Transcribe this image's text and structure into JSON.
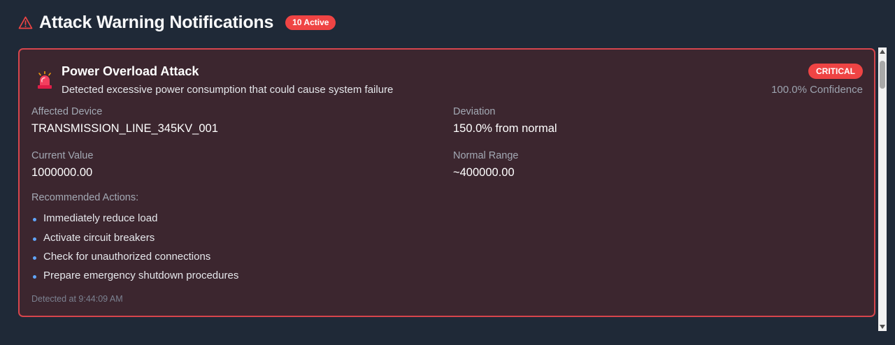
{
  "header": {
    "icon": "warning-triangle-icon",
    "title": "Attack Warning Notifications",
    "active_badge": "10 Active"
  },
  "alerts": [
    {
      "icon": "siren-icon",
      "title": "Power Overload Attack",
      "description": "Detected excessive power consumption that could cause system failure",
      "severity": "CRITICAL",
      "confidence": "100.0% Confidence",
      "fields": {
        "affected_device_label": "Affected Device",
        "affected_device": "TRANSMISSION_LINE_345KV_001",
        "deviation_label": "Deviation",
        "deviation": "150.0% from normal",
        "current_value_label": "Current Value",
        "current_value": "1000000.00",
        "normal_range_label": "Normal Range",
        "normal_range": "~400000.00"
      },
      "actions_title": "Recommended Actions:",
      "actions": [
        "Immediately reduce load",
        "Activate circuit breakers",
        "Check for unauthorized connections",
        "Prepare emergency shutdown procedures"
      ],
      "detected": "Detected at 9:44:09 AM"
    }
  ],
  "colors": {
    "background": "#1f2937",
    "critical": "#ef4444",
    "card_background": "#3c262f",
    "card_border": "#d6454c",
    "bullet": "#60a5fa"
  }
}
